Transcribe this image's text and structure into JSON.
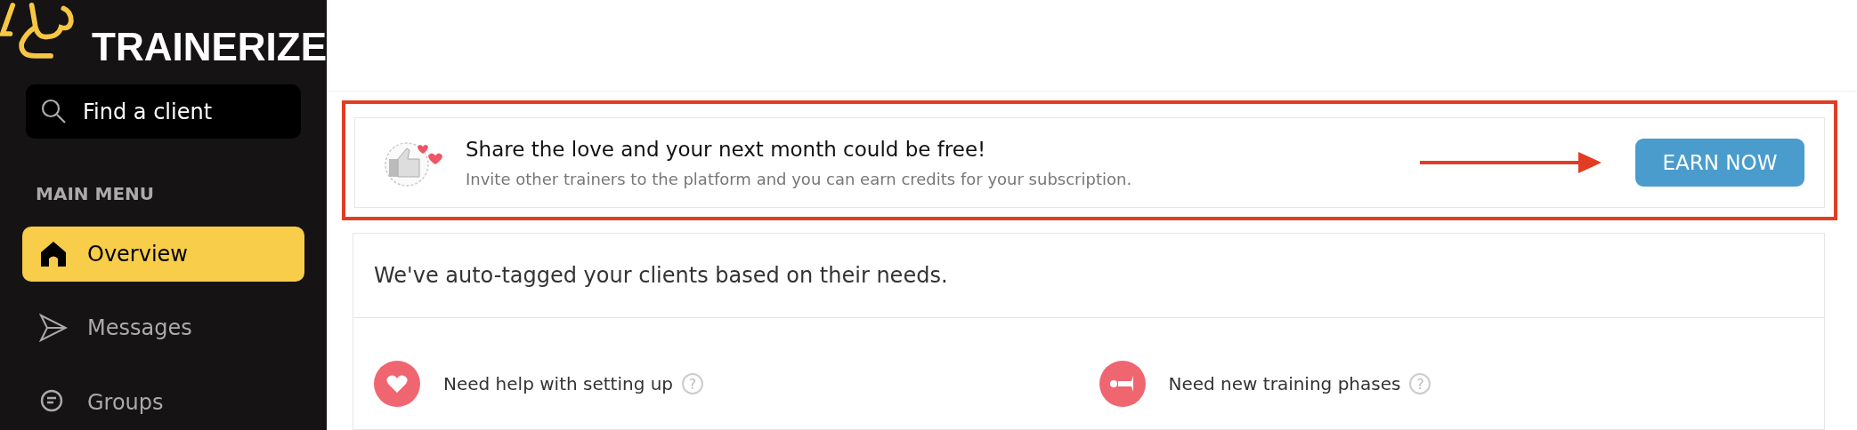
{
  "sidebar": {
    "brand": "TRAINERIZE",
    "search": {
      "placeholder": "Find a client"
    },
    "section_title": "MAIN MENU",
    "items": [
      {
        "label": "Overview",
        "kind": "home",
        "selected": true
      },
      {
        "label": "Messages",
        "kind": "send",
        "selected": false
      },
      {
        "label": "Groups",
        "kind": "chat",
        "selected": false
      }
    ]
  },
  "banner": {
    "title": "Share the love and your next month could be free!",
    "subtitle": "Invite other trainers to the platform and you can earn credits for your subscription.",
    "button": "EARN NOW"
  },
  "tags_card": {
    "heading": "We've auto-tagged your clients based on their needs.",
    "tags": [
      {
        "label": "Need help with setting up",
        "kind": "heart",
        "help": "?"
      },
      {
        "label": "Need new training phases",
        "kind": "horn",
        "help": "?"
      }
    ]
  }
}
